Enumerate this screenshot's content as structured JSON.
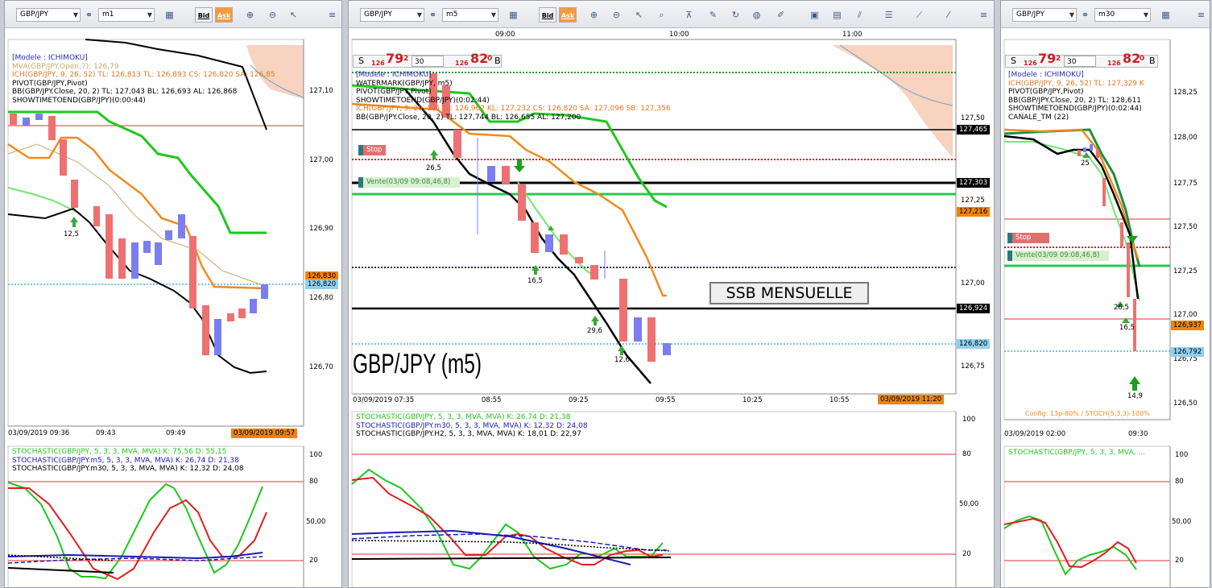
{
  "panels": [
    {
      "symbol": "GBP/JPY",
      "timeframe": "m1",
      "indicators": [
        {
          "text": "[Modele : ICHIMOKU]",
          "color": "#2a2ab8"
        },
        {
          "text": "MVA(GBP/JPY.Open,7): 126,79",
          "color": "#c8a86a"
        },
        {
          "text": "ICH(GBP/JPY, 9, 26, 52)  TL: 126,813  TL: 126,893  CS: 126,820  SA: 126,85",
          "color": "#e07820"
        },
        {
          "text": "PIVOT(GBP/JPY,Pivot)",
          "color": "#000000"
        },
        {
          "text": "BB(GBP/JPY.Close, 20, 2)  TL: 127,043  BL: 126,693  AL: 126,868",
          "color": "#000000"
        },
        {
          "text": "SHOWTIMETOEND(GBP/JPY)(0:00:44)",
          "color": "#000000"
        }
      ],
      "y_ticks": [
        "127,10",
        "127,00",
        "126,90",
        "126,80",
        "126,70"
      ],
      "price_tags": [
        {
          "text": "126,830",
          "bg": "#f0820a"
        },
        {
          "text": "126,820",
          "bg": "#8fd0f0"
        }
      ],
      "x_ticks": [
        "03/09/2019 09:36",
        "09:43",
        "09:49"
      ],
      "x_current": "03/09/2019 09:57",
      "markers": [
        "12,5"
      ],
      "stoch_legend": [
        {
          "text": "STOCHASTIC(GBP/JPY, 5, 3, 3, MVA, MVA)  K: 75,56  D: 55,15",
          "color": "#1ec81e"
        },
        {
          "text": "STOCHASTIC(GBP/JPY.m5, 5, 3, 3, MVA, MVA)  K: 26,74  D: 21,38",
          "color": "#1a1ab8"
        },
        {
          "text": "STOCHASTIC(GBP/JPY.m30, 5, 3, 3, MVA, MVA)  K: 12,32  D: 24,08",
          "color": "#000000"
        }
      ],
      "stoch_ticks": [
        "100",
        "80",
        "50,00",
        "20"
      ]
    },
    {
      "symbol": "GBP/JPY",
      "timeframe": "m5",
      "quote": {
        "sell_label": "S",
        "sell_prefix": "126",
        "sell_big": "79",
        "sell_sup": "2",
        "spread": "30",
        "buy_prefix": "126",
        "buy_big": "82",
        "buy_sup": "0",
        "buy_label": "B"
      },
      "indicators": [
        {
          "text": "[Modele : ICHIMOKU]",
          "color": "#2a2ab8"
        },
        {
          "text": "WATERMARK(GBP/JPY, m5)",
          "color": "#000000"
        },
        {
          "text": "PIVOT(GBP/JPY,Pivot)",
          "color": "#000000"
        },
        {
          "text": "SHOWTIMETOEND(GBP/JPY)(0:02:44)",
          "color": "#000000"
        },
        {
          "text": "ICH(GBP/JPY, 9, 26, 52)  TL: 126,962  KL: 127,232  CS: 126,820  SA: 127,096  SB: 127,356",
          "color": "#e07820"
        },
        {
          "text": "BB(GBP/JPY.Close, 20, 2)  TL: 127,744  BL: 126,655  AL: 127,200",
          "color": "#000000"
        }
      ],
      "top_ticks": [
        "09:00",
        "10:00",
        "11:00"
      ],
      "y_ticks": [
        "127,50",
        "127,25",
        "127,00",
        "126,75"
      ],
      "price_tags": [
        {
          "text": "127,465",
          "bg": "#000000"
        },
        {
          "text": "127,303",
          "bg": "#000000"
        },
        {
          "text": "127,216",
          "bg": "#f0820a"
        },
        {
          "text": "126,924",
          "bg": "#000000"
        },
        {
          "text": "126,820",
          "bg": "#8fd0f0"
        }
      ],
      "stop_label": "Stop",
      "vente_label": "Vente(03/09 09:08,46,8)",
      "annotation": "SSB MENSUELLE",
      "watermark": "GBP/JPY (m5)",
      "markers": [
        "26,5",
        "16,5",
        "29,6",
        "12,6"
      ],
      "x_ticks": [
        "03/09/2019 07:35",
        "08:55",
        "09:25",
        "09:55",
        "10:25",
        "10:55"
      ],
      "x_current": "03/09/2019 11:20",
      "stoch_legend": [
        {
          "text": "STOCHASTIC(GBP/JPY, 5, 3, 3, MVA, MVA)  K: 26,74  D: 21,38",
          "color": "#1ec81e"
        },
        {
          "text": "STOCHASTIC(GBP/JPY.m30, 5, 3, 3, MVA, MVA)  K: 12,32  D: 24,08",
          "color": "#1a1ab8"
        },
        {
          "text": "STOCHASTIC(GBP/JPY.H2, 5, 3, 3, MVA, MVA)  K: 18,01  D: 22,97",
          "color": "#000000"
        }
      ],
      "stoch_ticks": [
        "100",
        "80",
        "50,00",
        "20"
      ]
    },
    {
      "symbol": "GBP/JPY",
      "timeframe": "m30",
      "quote": {
        "sell_label": "S",
        "sell_prefix": "126",
        "sell_big": "79",
        "sell_sup": "2",
        "spread": "30",
        "buy_prefix": "126",
        "buy_big": "82",
        "buy_sup": "0",
        "buy_label": "B"
      },
      "indicators": [
        {
          "text": "[Modele : ICHIMOKU]",
          "color": "#2a2ab8"
        },
        {
          "text": "ICH(GBP/JPY, 9, 26, 52)  TL: 127,329  K",
          "color": "#e07820"
        },
        {
          "text": "PIVOT(GBP/JPY,Pivot)",
          "color": "#000000"
        },
        {
          "text": "BB(GBP/JPY.Close, 20, 2)  TL: 128,611",
          "color": "#000000"
        },
        {
          "text": "SHOWTIMETOEND(GBP/JPY)(0:02:44)",
          "color": "#000000"
        },
        {
          "text": "CANALE_TM (22)",
          "color": "#000000"
        }
      ],
      "y_ticks": [
        "128,25",
        "128,00",
        "127,75",
        "127,50",
        "127,25",
        "127,00",
        "126,75",
        "126,50"
      ],
      "price_tags": [
        {
          "text": "126,937",
          "bg": "#f0820a"
        },
        {
          "text": "126,792",
          "bg": "#8fd0f0"
        }
      ],
      "stop_label": "Stop",
      "vente_label": "Vente(03/09 09:08,46,8)",
      "markers": [
        "25",
        "26,5",
        "16,5",
        "14,9"
      ],
      "config_text": "Config: 13p-80% / STOCH(5,3,3)-100%",
      "x_ticks": [
        "03/09/2019 02:00",
        "09:30"
      ],
      "stoch_legend": [
        {
          "text": "STOCHASTIC(GBP/JPY, 5, 3, 3, MVA, ...",
          "color": "#1ec81e"
        }
      ],
      "stoch_ticks": [
        "100",
        "80",
        "50,00",
        "20"
      ]
    }
  ],
  "toolbar": {
    "bid_label": "Bid",
    "ask_label": "Ask"
  }
}
